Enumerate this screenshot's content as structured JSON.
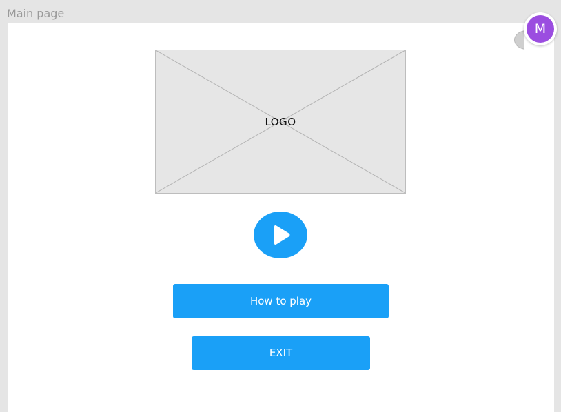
{
  "frame": {
    "label": "Main page"
  },
  "logo": {
    "text": "LOGO"
  },
  "play": {
    "icon": "play-icon"
  },
  "buttons": {
    "how_to_play": "How to play",
    "exit": "EXIT"
  },
  "avatar": {
    "initial": "M",
    "color": "#9b4de0"
  },
  "colors": {
    "accent": "#1aa0f7",
    "canvas_background": "#e5e5e5",
    "placeholder_fill": "#e6e6e6"
  }
}
